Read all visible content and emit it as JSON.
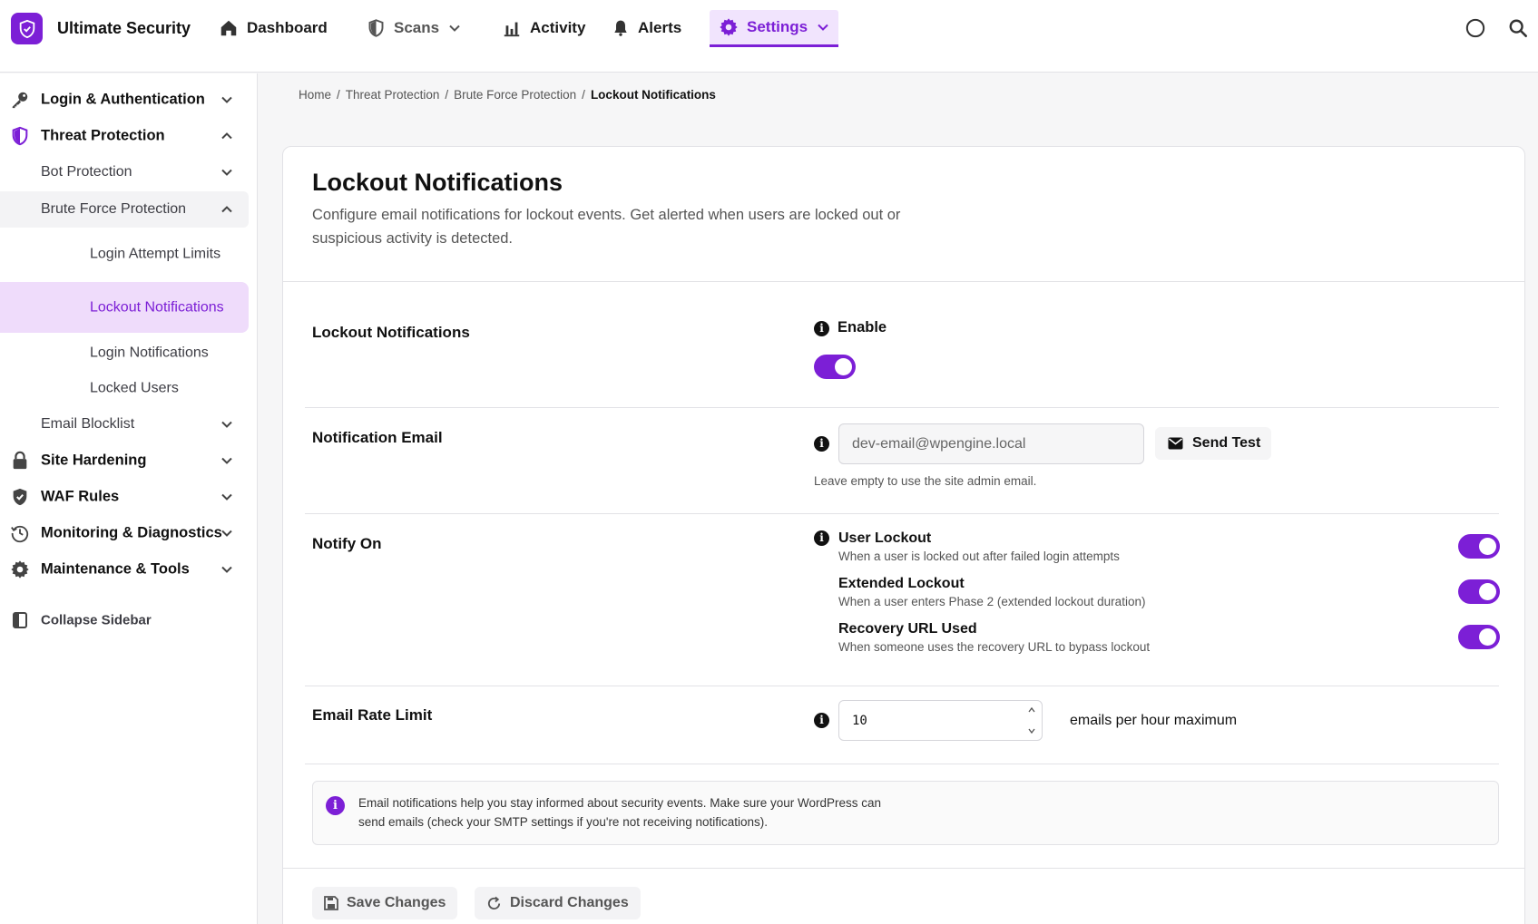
{
  "colors": {
    "accent": "#7c1fd6",
    "accent_light": "#efdcfb"
  },
  "app": {
    "name": "Ultimate Security",
    "logo_icon": "shield-check-icon"
  },
  "topnav": {
    "dashboard": "Dashboard",
    "scans": "Scans",
    "activity": "Activity",
    "alerts": "Alerts",
    "settings": "Settings"
  },
  "sidebar": {
    "login_auth": "Login & Authentication",
    "threat_protection": "Threat Protection",
    "bot_protection": "Bot Protection",
    "brute_force": "Brute Force Protection",
    "login_attempt_limits": "Login Attempt Limits",
    "lockout_notifications": "Lockout Notifications",
    "login_notifications": "Login Notifications",
    "locked_users": "Locked Users",
    "email_blocklist": "Email Blocklist",
    "site_hardening": "Site Hardening",
    "waf_rules": "WAF Rules",
    "monitoring": "Monitoring & Diagnostics",
    "maintenance": "Maintenance & Tools",
    "collapse": "Collapse Sidebar"
  },
  "breadcrumb": [
    "Home",
    "/",
    "Threat Protection",
    "/",
    "Brute Force Protection",
    "/",
    "Lockout Notifications"
  ],
  "page": {
    "title": "Lockout Notifications",
    "description": "Configure email notifications for lockout events. Get alerted when users are locked out or suspicious activity is detected."
  },
  "settings": {
    "lockout": {
      "label": "Lockout Notifications",
      "field_label": "Enable",
      "enabled": true
    },
    "email": {
      "label": "Notification Email",
      "value": "dev-email@wpengine.local",
      "send_test": "Send Test",
      "help": "Leave empty to use the site admin email."
    },
    "notify_on": {
      "label": "Notify On",
      "options": [
        {
          "title": "User Lockout",
          "desc": "When a user is locked out after failed login attempts",
          "enabled": true
        },
        {
          "title": "Extended Lockout",
          "desc": "When a user enters Phase 2 (extended lockout duration)",
          "enabled": true
        },
        {
          "title": "Recovery URL Used",
          "desc": "When someone uses the recovery URL to bypass lockout",
          "enabled": true
        }
      ]
    },
    "rate_limit": {
      "label": "Email Rate Limit",
      "value": "10",
      "suffix": "emails per hour maximum"
    }
  },
  "notice": "Email notifications help you stay informed about security events. Make sure your WordPress can send emails (check your SMTP settings if you're not receiving notifications).",
  "footer": {
    "save": "Save Changes",
    "discard": "Discard Changes"
  }
}
